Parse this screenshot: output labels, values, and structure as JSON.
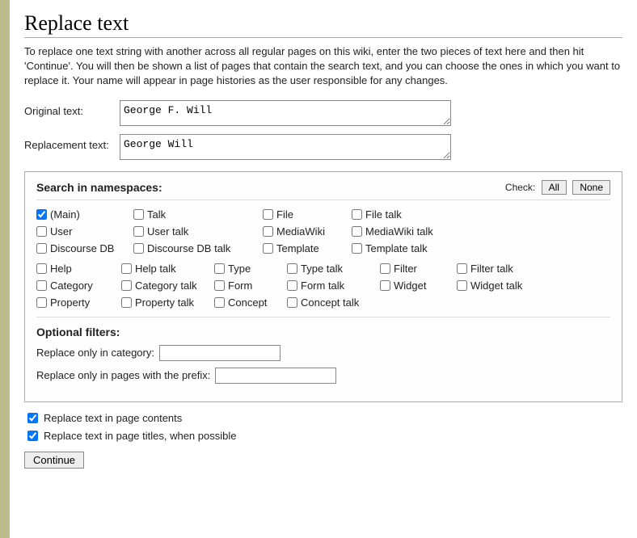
{
  "title": "Replace text",
  "intro": "To replace one text string with another across all regular pages on this wiki, enter the two pieces of text here and then hit 'Continue'. You will then be shown a list of pages that contain the search text, and you can choose the ones in which you want to replace it. Your name will appear in page histories as the user responsible for any changes.",
  "fields": {
    "original_label": "Original text:",
    "original_value": "George F. Will",
    "replacement_label": "Replacement text:",
    "replacement_value": "George Will"
  },
  "ns": {
    "heading": "Search in namespaces:",
    "check_label": "Check:",
    "all_btn": "All",
    "none_btn": "None",
    "group1": [
      [
        {
          "label": "(Main)",
          "checked": true
        },
        {
          "label": "Talk",
          "checked": false
        },
        {
          "label": "File",
          "checked": false
        },
        {
          "label": "File talk",
          "checked": false
        }
      ],
      [
        {
          "label": "User",
          "checked": false
        },
        {
          "label": "User talk",
          "checked": false
        },
        {
          "label": "MediaWiki",
          "checked": false
        },
        {
          "label": "MediaWiki talk",
          "checked": false
        }
      ],
      [
        {
          "label": "Discourse DB",
          "checked": false
        },
        {
          "label": "Discourse DB talk",
          "checked": false
        },
        {
          "label": "Template",
          "checked": false
        },
        {
          "label": "Template talk",
          "checked": false
        }
      ]
    ],
    "group2": [
      [
        {
          "label": "Help",
          "checked": false
        },
        {
          "label": "Help talk",
          "checked": false
        },
        {
          "label": "Type",
          "checked": false
        },
        {
          "label": "Type talk",
          "checked": false
        },
        {
          "label": "Filter",
          "checked": false
        },
        {
          "label": "Filter talk",
          "checked": false
        }
      ],
      [
        {
          "label": "Category",
          "checked": false
        },
        {
          "label": "Category talk",
          "checked": false
        },
        {
          "label": "Form",
          "checked": false
        },
        {
          "label": "Form talk",
          "checked": false
        },
        {
          "label": "Widget",
          "checked": false
        },
        {
          "label": "Widget talk",
          "checked": false
        }
      ],
      [
        {
          "label": "Property",
          "checked": false
        },
        {
          "label": "Property talk",
          "checked": false
        },
        {
          "label": "Concept",
          "checked": false
        },
        {
          "label": "Concept talk",
          "checked": false
        }
      ]
    ]
  },
  "opt": {
    "heading": "Optional filters:",
    "category_label": "Replace only in category:",
    "category_value": "",
    "prefix_label": "Replace only in pages with the prefix:",
    "prefix_value": ""
  },
  "bottom": {
    "contents": {
      "label": "Replace text in page contents",
      "checked": true
    },
    "titles": {
      "label": "Replace text in page titles, when possible",
      "checked": true
    }
  },
  "continue_btn": "Continue"
}
